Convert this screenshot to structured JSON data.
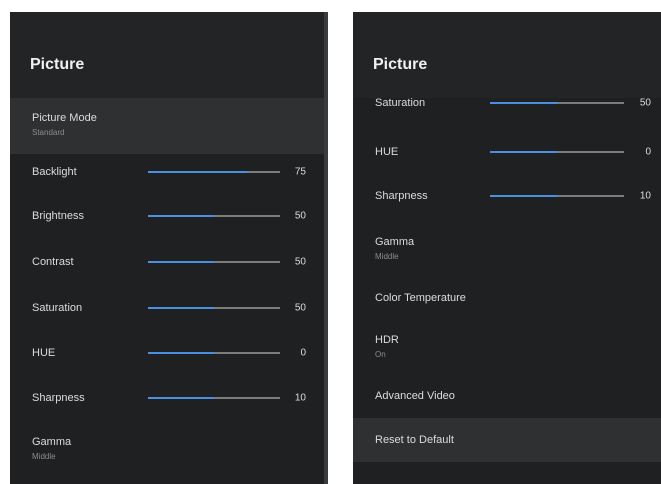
{
  "left": {
    "title": "Picture",
    "picture_mode": {
      "label": "Picture Mode",
      "value": "Standard"
    },
    "sliders": [
      {
        "label": "Backlight",
        "value": "75",
        "level": 0.75
      },
      {
        "label": "Brightness",
        "value": "50",
        "level": 0.5
      },
      {
        "label": "Contrast",
        "value": "50",
        "level": 0.5
      },
      {
        "label": "Saturation",
        "value": "50",
        "level": 0.5
      },
      {
        "label": "HUE",
        "value": "0",
        "level": 0.5
      },
      {
        "label": "Sharpness",
        "value": "10",
        "level": 0.5
      }
    ],
    "gamma": {
      "label": "Gamma",
      "value": "Middle"
    }
  },
  "right": {
    "title": "Picture",
    "sliders": [
      {
        "label": "Saturation",
        "value": "50",
        "level": 0.5
      },
      {
        "label": "HUE",
        "value": "0",
        "level": 0.5
      },
      {
        "label": "Sharpness",
        "value": "10",
        "level": 0.5
      }
    ],
    "gamma": {
      "label": "Gamma",
      "value": "Middle"
    },
    "color_temperature": "Color Temperature",
    "hdr": {
      "label": "HDR",
      "value": "On"
    },
    "advanced_video": "Advanced Video",
    "reset": "Reset to Default"
  },
  "colors": {
    "accent": "#4a8fe0",
    "panel_bg": "#1f2021",
    "selected_bg": "#2f3031"
  }
}
